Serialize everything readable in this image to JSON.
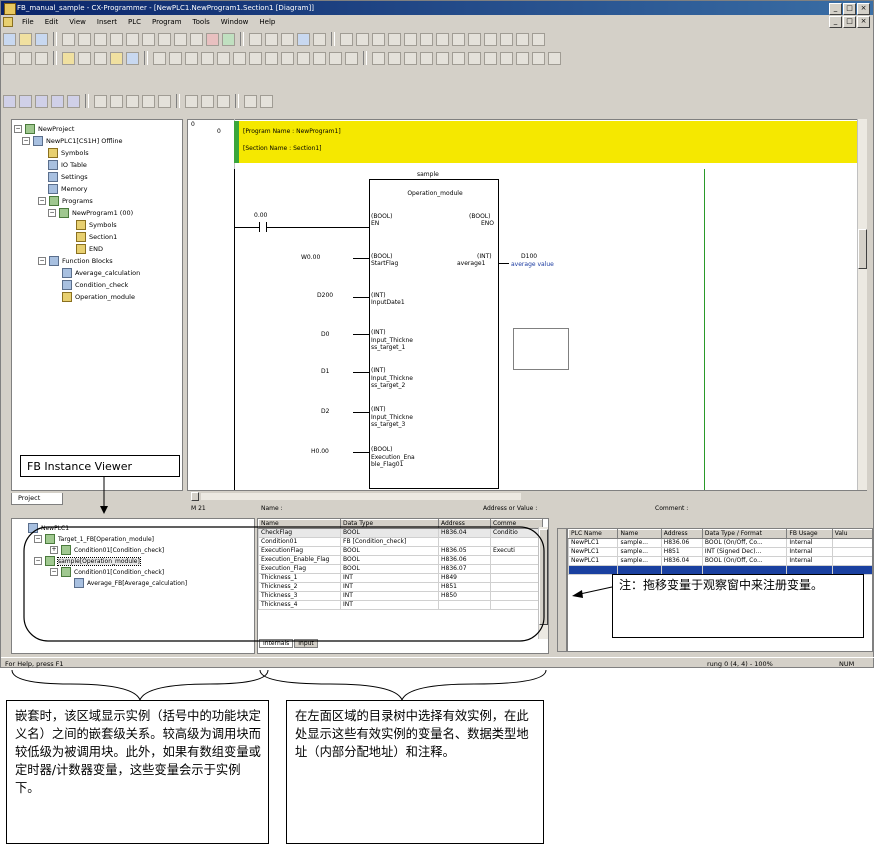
{
  "window": {
    "title": "FB_manual_sample - CX-Programmer - [NewPLC1.NewProgram1.Section1 [Diagram]]",
    "min_label": "_",
    "max_label": "□",
    "close_label": "×"
  },
  "menu": [
    "File",
    "Edit",
    "View",
    "Insert",
    "PLC",
    "Program",
    "Tools",
    "Window",
    "Help"
  ],
  "project_tree": {
    "tab_label": "Project",
    "items": [
      {
        "label": "NewProject"
      },
      {
        "label": "NewPLC1[CS1H] Offline"
      },
      {
        "label": "Symbols"
      },
      {
        "label": "IO Table"
      },
      {
        "label": "Settings"
      },
      {
        "label": "Memory"
      },
      {
        "label": "Programs"
      },
      {
        "label": "NewProgram1 (00)"
      },
      {
        "label": "Symbols"
      },
      {
        "label": "Section1"
      },
      {
        "label": "END"
      },
      {
        "label": "Function Blocks"
      },
      {
        "label": "Average_calculation"
      },
      {
        "label": "Condition_check"
      },
      {
        "label": "Operation_module"
      }
    ]
  },
  "diagram": {
    "rung_number": "0",
    "rung_step": "0",
    "program_name": "[Program Name : NewProgram1]",
    "section_name": "[Section Name : Section1]",
    "instance_name": "sample",
    "fb_name": "Operation_module",
    "contact_address": "0.00",
    "inputs": [
      {
        "operand": "",
        "type": "(BOOL)",
        "name": "EN"
      },
      {
        "operand": "W0.00",
        "type": "(BOOL)",
        "name": "StartFlag"
      },
      {
        "operand": "D200",
        "type": "(INT)",
        "name": "InputDate1"
      },
      {
        "operand": "D0",
        "type": "(INT)",
        "name": "Input_Thickne ss_target_1"
      },
      {
        "operand": "D1",
        "type": "(INT)",
        "name": "Input_Thickne ss_target_2"
      },
      {
        "operand": "D2",
        "type": "(INT)",
        "name": "Input_Thickne ss_target_3"
      },
      {
        "operand": "H0.00",
        "type": "(BOOL)",
        "name": "Execution_Ena ble_Flag01"
      }
    ],
    "outputs": [
      {
        "type": "(BOOL)",
        "name": "ENO",
        "operand": "",
        "comment": ""
      },
      {
        "type": "(INT)",
        "name": "average1",
        "operand": "D100",
        "comment": "average value"
      }
    ],
    "footer_cols": [
      "Name :",
      "Address or Value :",
      "Comment :"
    ]
  },
  "fb_instance_viewer": {
    "callout_label": "FB Instance Viewer",
    "tree": [
      {
        "label": "NewPLC1"
      },
      {
        "label": "Target_1_FB[Operation_module]"
      },
      {
        "label": "Condition01[Condition_check]"
      },
      {
        "label": "sample[Operation_module]"
      },
      {
        "label": "Condition01[Condition_check]"
      },
      {
        "label": "Average_FB[Average_calculation]"
      }
    ],
    "table_headers": [
      "Name",
      "Data Type",
      "Address",
      "Comme"
    ],
    "rows": [
      [
        "CheckFlag",
        "BOOL",
        "H836.04",
        "Conditio"
      ],
      [
        "Condition01",
        "FB [Condition_check]",
        "",
        ""
      ],
      [
        "ExecutionFlag",
        "BOOL",
        "H836.05",
        "Executi"
      ],
      [
        "Execution_Enable_Flag",
        "BOOL",
        "H836.06",
        ""
      ],
      [
        "Execution_Flag",
        "BOOL",
        "H836.07",
        ""
      ],
      [
        "Thickness_1",
        "INT",
        "H849",
        ""
      ],
      [
        "Thickness_2",
        "INT",
        "H851",
        ""
      ],
      [
        "Thickness_3",
        "INT",
        "H850",
        ""
      ],
      [
        "Thickness_4",
        "INT",
        "",
        ""
      ]
    ],
    "tabs": [
      "Internals",
      "Input"
    ]
  },
  "watch_window": {
    "headers": [
      "PLC Name",
      "Name",
      "Address",
      "Data Type / Format",
      "FB Usage",
      "Valu"
    ],
    "rows": [
      [
        "NewPLC1",
        "sample...",
        "H836.06",
        "BOOL (On/Off, Co...",
        "Internal"
      ],
      [
        "NewPLC1",
        "sample...",
        "H851",
        "INT (Signed Dec)...",
        "Internal"
      ],
      [
        "NewPLC1",
        "sample...",
        "H836.04",
        "BOOL (On/Off, Co...",
        "Internal"
      ]
    ]
  },
  "statusbar": {
    "help_text": "For Help, press F1",
    "position": "rung 0 (4, 4) - 100%",
    "mode": "NUM"
  },
  "annotations": {
    "watch_note": "注：拖移变量于观察窗中来注册变量。",
    "left_note": "嵌套时，该区域显示实例（括号中的功能块定义名）之间的嵌套级关系。较高级为调用块而较低级为被调用块。此外，如果有数组变量或定时器/计数器变量，这些变量会示于实例下。",
    "right_note": "在左面区域的目录树中选择有效实例，在此处显示这些有效实例的变量名、数据类型地址（内部分配地址）和注释。"
  }
}
